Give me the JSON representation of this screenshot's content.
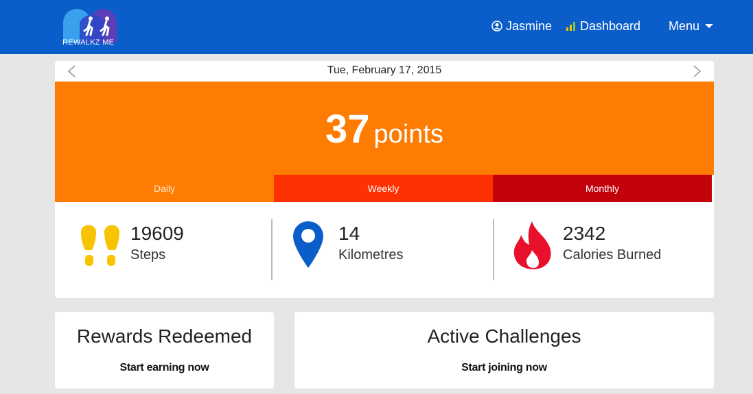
{
  "app": {
    "logo_text": "REWALKZ ME",
    "brand_color": "#0b5ec9"
  },
  "nav": {
    "user_label": "Jasmine",
    "dashboard_label": "Dashboard",
    "menu_label": "Menu"
  },
  "date_nav": {
    "date": "Tue, February 17, 2015",
    "prev_icon": "chevron-left-icon",
    "next_icon": "chevron-right-icon"
  },
  "points": {
    "value": "37",
    "unit": "points",
    "color": "#ff7c02"
  },
  "tabs": [
    {
      "label": "Daily",
      "color": "#ff7c02",
      "selected": true
    },
    {
      "label": "Weekly",
      "color": "#fd3102",
      "selected": false
    },
    {
      "label": "Monthly",
      "color": "#c4020c",
      "selected": false
    }
  ],
  "stats": [
    {
      "value": "19609",
      "label": "Steps",
      "icon": "footprints-icon",
      "color": "#f8c300"
    },
    {
      "value": "14",
      "label": "Kilometres",
      "icon": "map-pin-icon",
      "color": "#0b5ec9"
    },
    {
      "value": "2342",
      "label": "Calories Burned",
      "icon": "flame-icon",
      "color": "#e8102a"
    }
  ],
  "cards": {
    "rewards": {
      "title": "Rewards Redeemed",
      "link": "Start earning now"
    },
    "challenges": {
      "title": "Active Challenges",
      "link": "Start joining now"
    }
  }
}
